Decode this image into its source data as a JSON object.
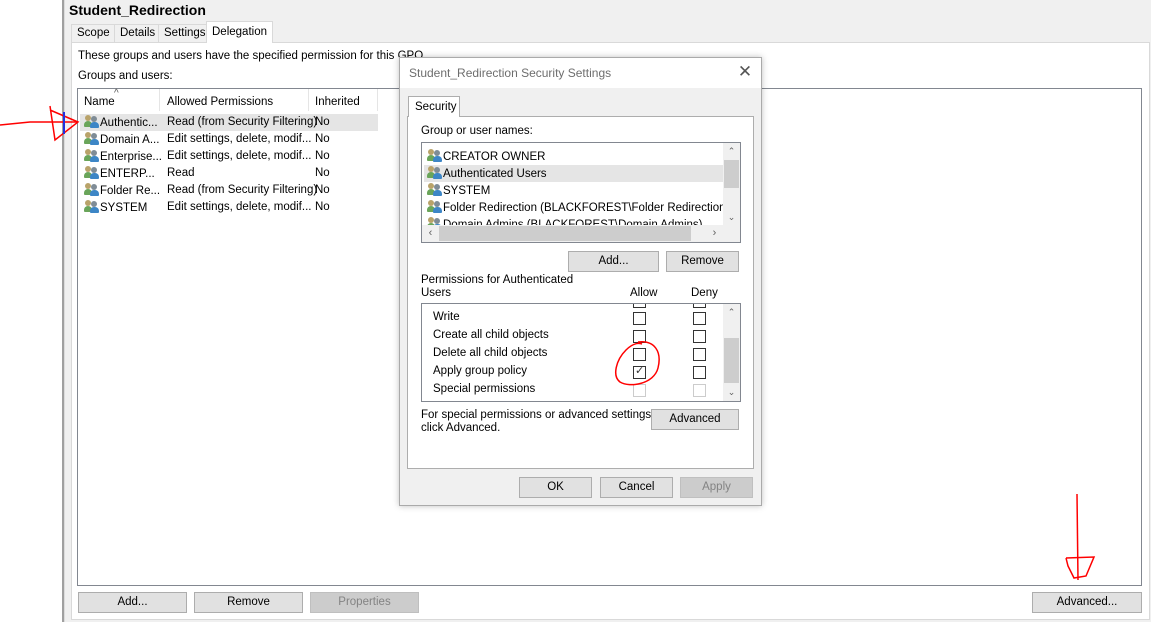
{
  "gpo": {
    "title": "Student_Redirection",
    "tabs": [
      {
        "label": "Scope",
        "active": false
      },
      {
        "label": "Details",
        "active": false
      },
      {
        "label": "Settings",
        "active": false
      },
      {
        "label": "Delegation",
        "active": true
      }
    ],
    "description": "These groups and users have the specified permission for this GPO",
    "groups_label": "Groups and users:",
    "list": {
      "columns": [
        "Name",
        "Allowed Permissions",
        "Inherited"
      ],
      "sort_indicator": "^",
      "rows": [
        {
          "name": "Authentic...",
          "permissions": "Read (from Security Filtering)",
          "inherited": "No",
          "selected": true
        },
        {
          "name": "Domain A...",
          "permissions": "Edit settings, delete, modif...",
          "inherited": "No",
          "selected": false
        },
        {
          "name": "Enterprise...",
          "permissions": "Edit settings, delete, modif...",
          "inherited": "No",
          "selected": false
        },
        {
          "name": "ENTERP...",
          "permissions": "Read",
          "inherited": "No",
          "selected": false
        },
        {
          "name": "Folder Re...",
          "permissions": "Read (from Security Filtering)",
          "inherited": "No",
          "selected": false
        },
        {
          "name": "SYSTEM",
          "permissions": "Edit settings, delete, modif...",
          "inherited": "No",
          "selected": false
        }
      ]
    },
    "buttons": {
      "add": "Add...",
      "remove": "Remove",
      "properties": "Properties",
      "advanced": "Advanced..."
    }
  },
  "dialog": {
    "title": "Student_Redirection Security Settings",
    "close_glyph": "✕",
    "tab": "Security",
    "group_names_label": "Group or user names:",
    "users": [
      {
        "name": "CREATOR OWNER",
        "selected": false
      },
      {
        "name": "Authenticated Users",
        "selected": true
      },
      {
        "name": "SYSTEM",
        "selected": false
      },
      {
        "name": "Folder Redirection (BLACKFOREST\\Folder Redirection)",
        "selected": false
      },
      {
        "name": "Domain Admins (BLACKFOREST\\Domain Admins)",
        "selected": false
      }
    ],
    "add_button": "Add...",
    "remove_button": "Remove",
    "permissions_label_line1": "Permissions for Authenticated",
    "permissions_label_line2": "Users",
    "allow_header": "Allow",
    "deny_header": "Deny",
    "permissions": [
      {
        "name": "Write",
        "allow": false,
        "deny": false,
        "disabled": false
      },
      {
        "name": "Create all child objects",
        "allow": false,
        "deny": false,
        "disabled": false
      },
      {
        "name": "Delete all child objects",
        "allow": false,
        "deny": false,
        "disabled": false
      },
      {
        "name": "Apply group policy",
        "allow": true,
        "deny": false,
        "disabled": false
      },
      {
        "name": "Special permissions",
        "allow": false,
        "deny": false,
        "disabled": true
      }
    ],
    "advanced_hint_line1": "For special permissions or advanced settings,",
    "advanced_hint_line2": "click Advanced.",
    "advanced_button": "Advanced",
    "ok_button": "OK",
    "cancel_button": "Cancel",
    "apply_button": "Apply"
  },
  "annotations": {
    "color": "#ff0000"
  }
}
